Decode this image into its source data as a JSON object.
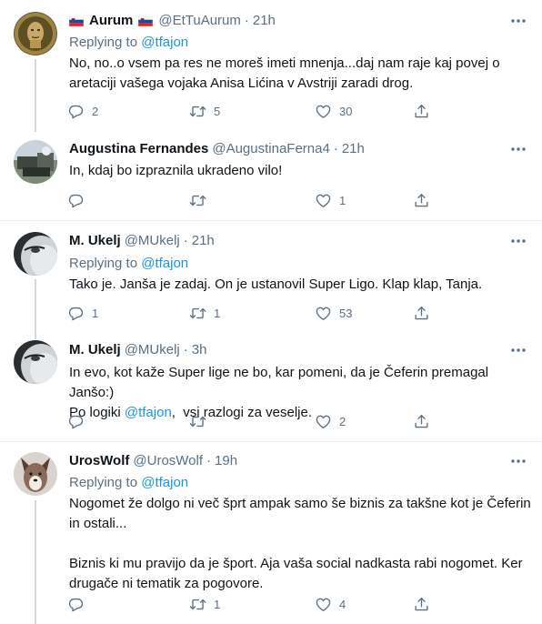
{
  "colors": {
    "text": "#0f1419",
    "secondary": "#5b7083",
    "link": "#1b95e0",
    "divider": "#ebeef0",
    "thread_line": "#cfd9de"
  },
  "tweets": [
    {
      "name": "Aurum",
      "flag_before": "slovenia-flag-icon",
      "flag_after": "slovenia-flag-icon",
      "handle": "@EtTuAurum",
      "sep": "·",
      "time": "21h",
      "replying_prefix": "Replying to",
      "replying_to": "@tfajon",
      "text_lines": [
        "No, no..o vsem pa res ne moreš imeti mnenja...daj nam raje kaj povej o",
        "aretaciji vašega vojaka Anisa Lićina v Avstriji zaradi drog."
      ],
      "replies": "2",
      "retweets": "5",
      "likes": "30"
    },
    {
      "name": "Augustina Fernandes",
      "handle": "@AugustinaFerna4",
      "sep": "·",
      "time": "21h",
      "text_lines": [
        "In, kdaj bo izpraznila ukradeno vilo!"
      ],
      "replies": "",
      "retweets": "",
      "likes": "1"
    },
    {
      "name": "M. Ukelj",
      "handle": "@MUkelj",
      "sep": "·",
      "time": "21h",
      "replying_prefix": "Replying to",
      "replying_to": "@tfajon",
      "text_lines": [
        "Tako je. Janša je zadaj. On je ustanovil Super Ligo. Klap klap, Tanja."
      ],
      "replies": "1",
      "retweets": "1",
      "likes": "53"
    },
    {
      "name": "M. Ukelj",
      "handle": "@MUkelj",
      "sep": "·",
      "time": "3h",
      "text_line1": "In evo, kot kaže Super lige ne bo, kar pomeni, da je Čeferin premagal Janšo:)",
      "text_line2_pre": "Po logiki ",
      "text_line2_mention": "@tfajon",
      "text_line2_post": ",  vsi razlogi za veselje.",
      "replies": "",
      "retweets": "",
      "likes": "2"
    },
    {
      "name": "UrosWolf",
      "handle": "@UrosWolf",
      "sep": "·",
      "time": "19h",
      "replying_prefix": "Replying to",
      "replying_to": "@tfajon",
      "para1": [
        "Nogomet že dolgo ni več šprt ampak samo še biznis za takšne kot je Čeferin",
        "in ostali..."
      ],
      "para2": [
        "Biznis ki mu pravijo da je šport. Aja vaša social nadkasta rabi nogomet. Ker",
        "drugače ni tematik za pogovore."
      ],
      "replies": "",
      "retweets": "1",
      "likes": "4"
    }
  ]
}
